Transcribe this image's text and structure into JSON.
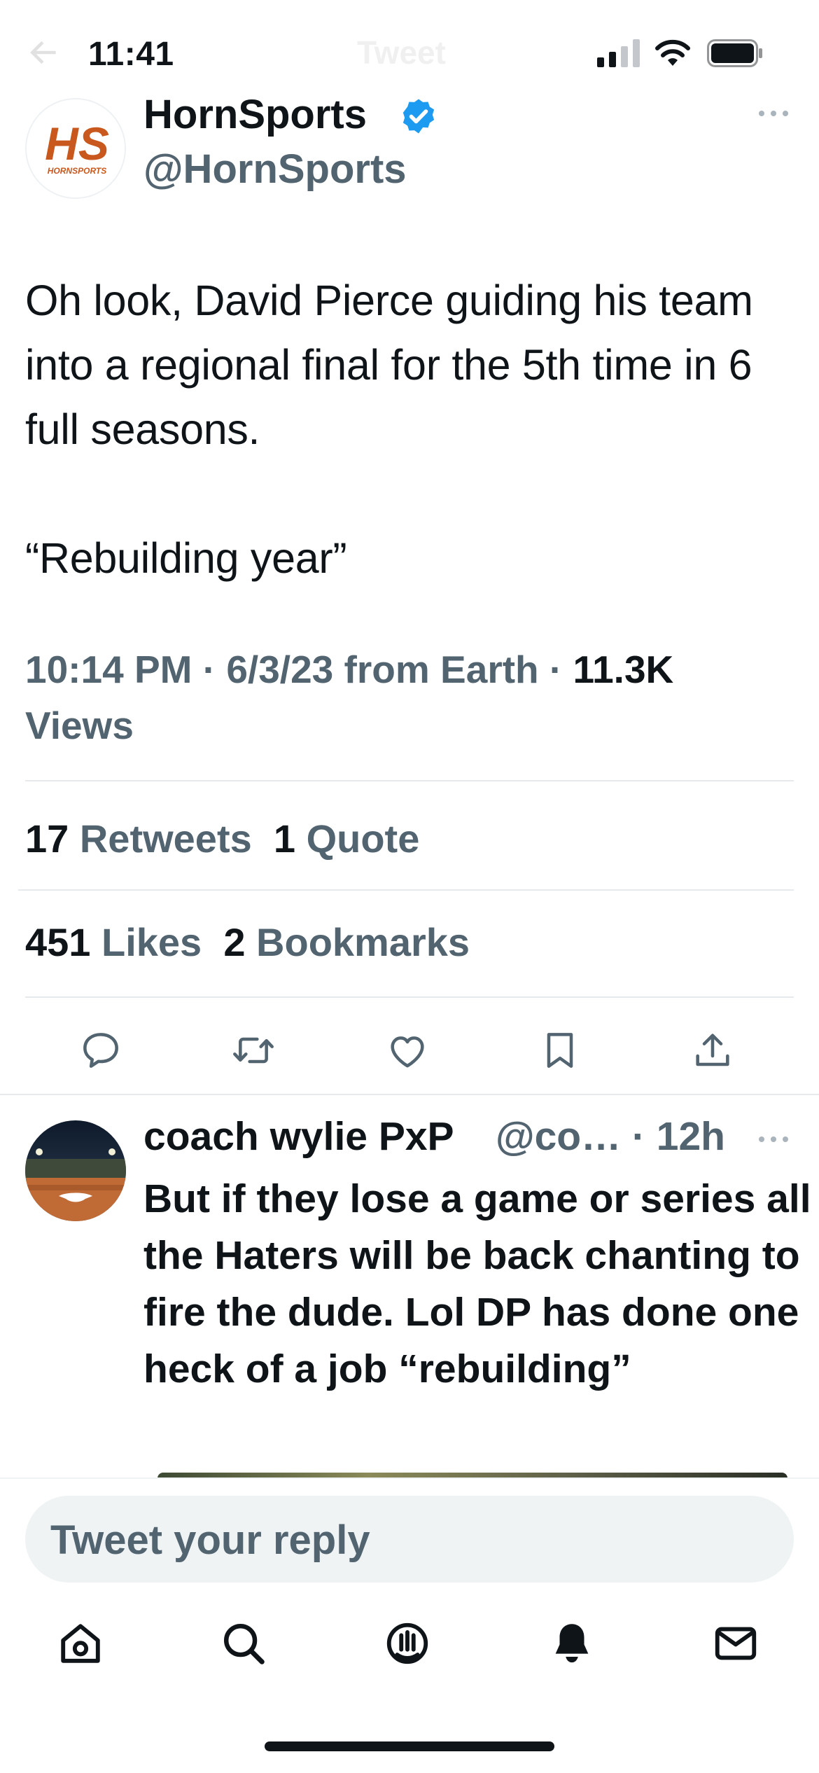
{
  "status_bar": {
    "time": "11:41",
    "nav_title": "Tweet"
  },
  "author": {
    "display_name": "HornSports",
    "handle": "@HornSports",
    "avatar_logo_text": "HS",
    "avatar_logo_sub": "HORNSPORTS",
    "verified": true
  },
  "tweet": {
    "text": "Oh look, David Pierce guiding his team into a regional final for the 5th time in 6 full seasons.\n\n“Rebuilding year”",
    "time": "10:14 PM",
    "date": "6/3/23",
    "source": "from Earth",
    "views_count": "11.3K",
    "views_label": "Views"
  },
  "stats": {
    "retweets_count": "17",
    "retweets_label": "Retweets",
    "quotes_count": "1",
    "quotes_label": "Quote",
    "likes_count": "451",
    "likes_label": "Likes",
    "bookmarks_count": "2",
    "bookmarks_label": "Bookmarks"
  },
  "reply": {
    "display_name": "coach wylie PxP",
    "handle_time": "@co… · 12h",
    "text": "But if they lose a game or series all the Haters will be back chanting to fire the dude. Lol DP has done one  heck of a job “rebuilding”"
  },
  "composer": {
    "placeholder": "Tweet your reply"
  },
  "icons": {
    "actions": [
      "reply-icon",
      "retweet-icon",
      "like-icon",
      "bookmark-icon",
      "share-icon"
    ],
    "tabs": [
      "home-icon",
      "search-icon",
      "spaces-icon",
      "notifications-icon",
      "messages-icon"
    ]
  },
  "colors": {
    "text_primary": "#0f1419",
    "text_secondary": "#536471",
    "verified_blue": "#1d9bf0",
    "logo_orange": "#c8581d",
    "divider": "#e6eaed"
  }
}
